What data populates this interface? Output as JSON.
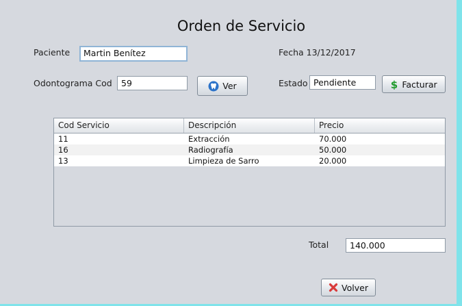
{
  "title": "Orden de Servicio",
  "paciente": {
    "label": "Paciente",
    "value": "Martin Benítez"
  },
  "fecha": {
    "text": "Fecha 13/12/2017"
  },
  "odontograma": {
    "label": "Odontograma Cod",
    "value": "59"
  },
  "ver_button": {
    "label": "Ver",
    "icon": "tooth-icon"
  },
  "estado": {
    "label": "Estado",
    "value": "Pendiente"
  },
  "facturar_button": {
    "label": "Facturar",
    "icon": "dollar-icon"
  },
  "table": {
    "columns": [
      "Cod Servicio",
      "Descripción",
      "Precio"
    ],
    "rows": [
      [
        "11",
        "Extracción",
        "70.000"
      ],
      [
        "16",
        "Radiografía",
        "50.000"
      ],
      [
        "13",
        "Limpieza de Sarro",
        "20.000"
      ]
    ]
  },
  "total": {
    "label": "Total",
    "value": "140.000"
  },
  "volver_button": {
    "label": "Volver",
    "icon": "close-x-icon"
  },
  "colors": {
    "window_bg": "#d6d9df",
    "desktop": "#7fe3ea",
    "dollar_green": "#1f9a2c",
    "close_red": "#d93a3a",
    "tooth_blue": "#2c73c9"
  }
}
